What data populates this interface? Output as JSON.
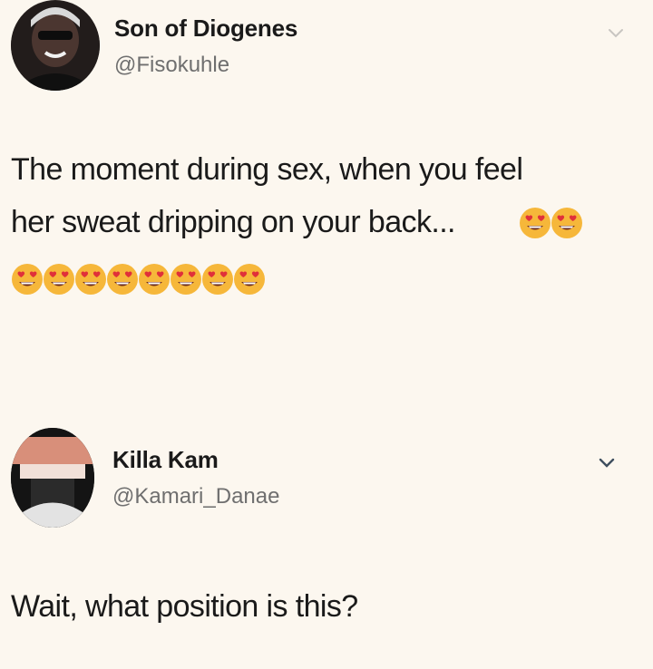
{
  "tweets": [
    {
      "display_name": "Son of Diogenes",
      "handle": "@Fisokuhle",
      "text_line1": "The moment during sex, when you feel",
      "text_line2": "her sweat dripping on your back...",
      "emoji_icon": "heart-eyes-emoji",
      "inline_emoji_count": 2,
      "trailing_emoji_count": 8
    },
    {
      "display_name": "Killa Kam",
      "handle": "@Kamari_Danae",
      "text": "Wait, what position is this?"
    }
  ],
  "colors": {
    "background": "#fcf7ef",
    "text": "#1a1a1a",
    "handle": "#6f6f6f",
    "emoji_face": "#f6b73a",
    "emoji_heart": "#e0303a"
  }
}
